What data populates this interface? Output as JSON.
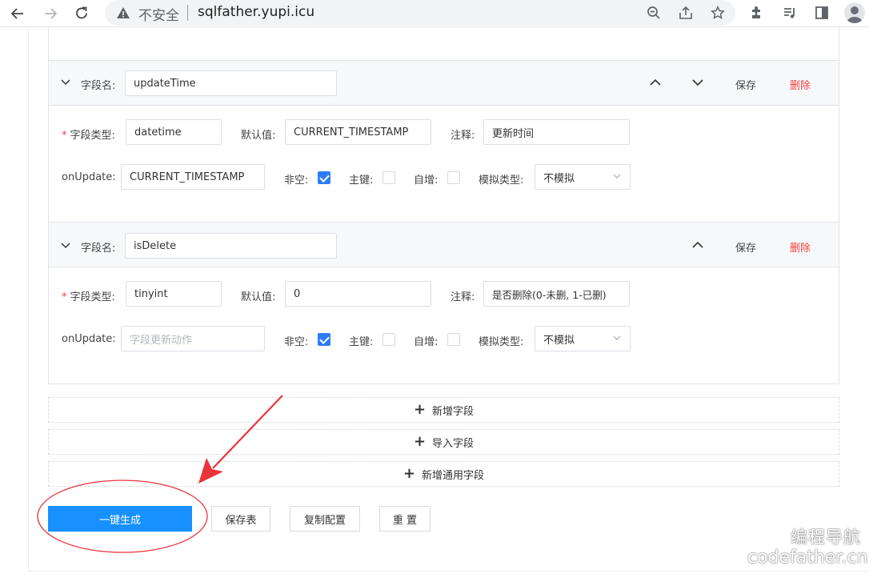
{
  "browser": {
    "insecure_label": "不安全",
    "url": "sqlfather.yupi.icu"
  },
  "fields": [
    {
      "name_label": "字段名",
      "name_value": "updateTime",
      "type_label": "字段类型",
      "type_value": "datetime",
      "default_label": "默认值",
      "default_value": "CURRENT_TIMESTAMP",
      "comment_label": "注释",
      "comment_value": "更新时间",
      "onupdate_label": "onUpdate",
      "onupdate_value": "CURRENT_TIMESTAMP",
      "onupdate_placeholder": "",
      "notnull_label": "非空",
      "notnull": true,
      "primary_label": "主键",
      "primary": false,
      "autoinc_label": "自增",
      "autoinc": false,
      "mock_label": "模拟类型",
      "mock_value": "不模拟",
      "save_label": "保存",
      "delete_label": "删除"
    },
    {
      "name_label": "字段名",
      "name_value": "isDelete",
      "type_label": "字段类型",
      "type_value": "tinyint",
      "default_label": "默认值",
      "default_value": "0",
      "comment_label": "注释",
      "comment_value": "是否删除(0-未删, 1-已删)",
      "onupdate_label": "onUpdate",
      "onupdate_value": "",
      "onupdate_placeholder": "字段更新动作",
      "notnull_label": "非空",
      "notnull": true,
      "primary_label": "主键",
      "primary": false,
      "autoinc_label": "自增",
      "autoinc": false,
      "mock_label": "模拟类型",
      "mock_value": "不模拟",
      "save_label": "保存",
      "delete_label": "删除"
    }
  ],
  "actions": {
    "add_field": "新增字段",
    "import_field": "导入字段",
    "add_common_field": "新增通用字段",
    "generate": "一键生成",
    "save_table": "保存表",
    "copy_config": "复制配置",
    "reset": "重 置"
  },
  "watermark": {
    "line1": "编程导航",
    "line2": "codefather.cn"
  },
  "colors": {
    "primary": "#1890ff",
    "danger": "#f53f3f",
    "annotation": "#e8343a"
  }
}
